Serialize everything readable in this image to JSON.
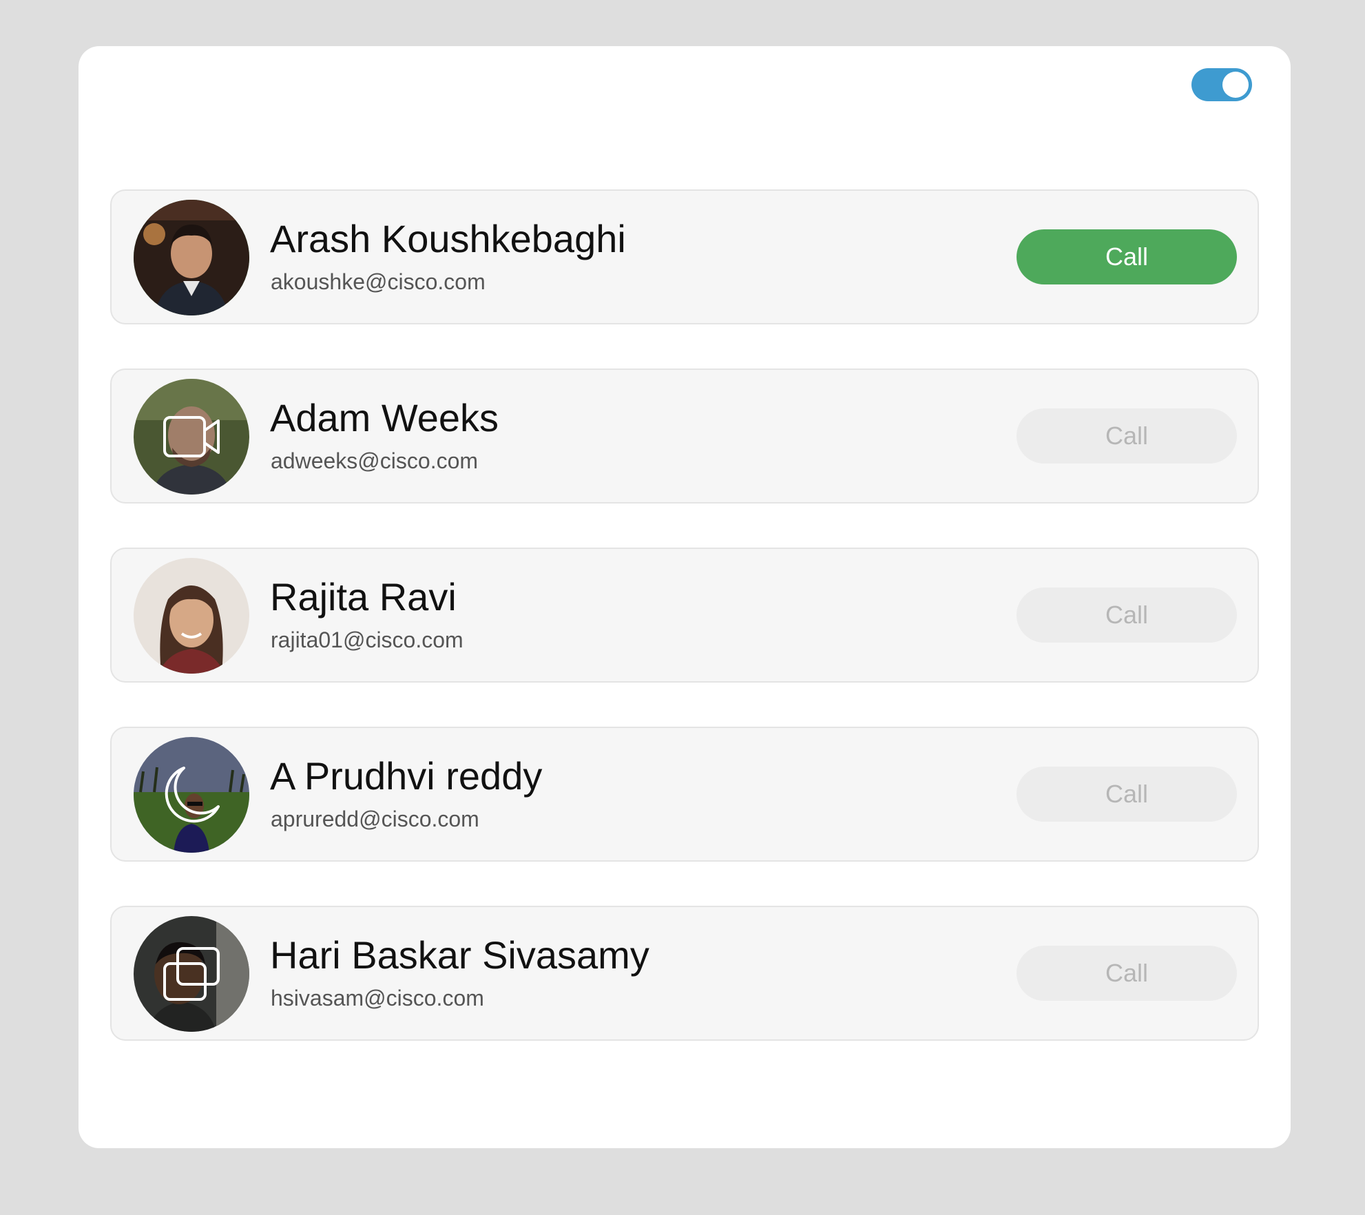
{
  "toggle": {
    "state": "on",
    "color": "#3e9bd0"
  },
  "contacts": [
    {
      "name": "Arash Koushkebaghi",
      "email": "akoushke@cisco.com",
      "call_label": "Call",
      "call_enabled": true,
      "status_icon": "none"
    },
    {
      "name": "Adam Weeks",
      "email": "adweeks@cisco.com",
      "call_label": "Call",
      "call_enabled": false,
      "status_icon": "video-camera-icon"
    },
    {
      "name": "Rajita Ravi",
      "email": "rajita01@cisco.com",
      "call_label": "Call",
      "call_enabled": false,
      "status_icon": "none"
    },
    {
      "name": "A Prudhvi reddy",
      "email": "apruredd@cisco.com",
      "call_label": "Call",
      "call_enabled": false,
      "status_icon": "moon-icon"
    },
    {
      "name": "Hari Baskar Sivasamy",
      "email": "hsivasam@cisco.com",
      "call_label": "Call",
      "call_enabled": false,
      "status_icon": "screen-share-icon"
    }
  ],
  "colors": {
    "call_active": "#4ea95b",
    "call_disabled": "#ececec",
    "call_disabled_text": "#b6b6b6",
    "active_ring": "#3a9a49"
  }
}
